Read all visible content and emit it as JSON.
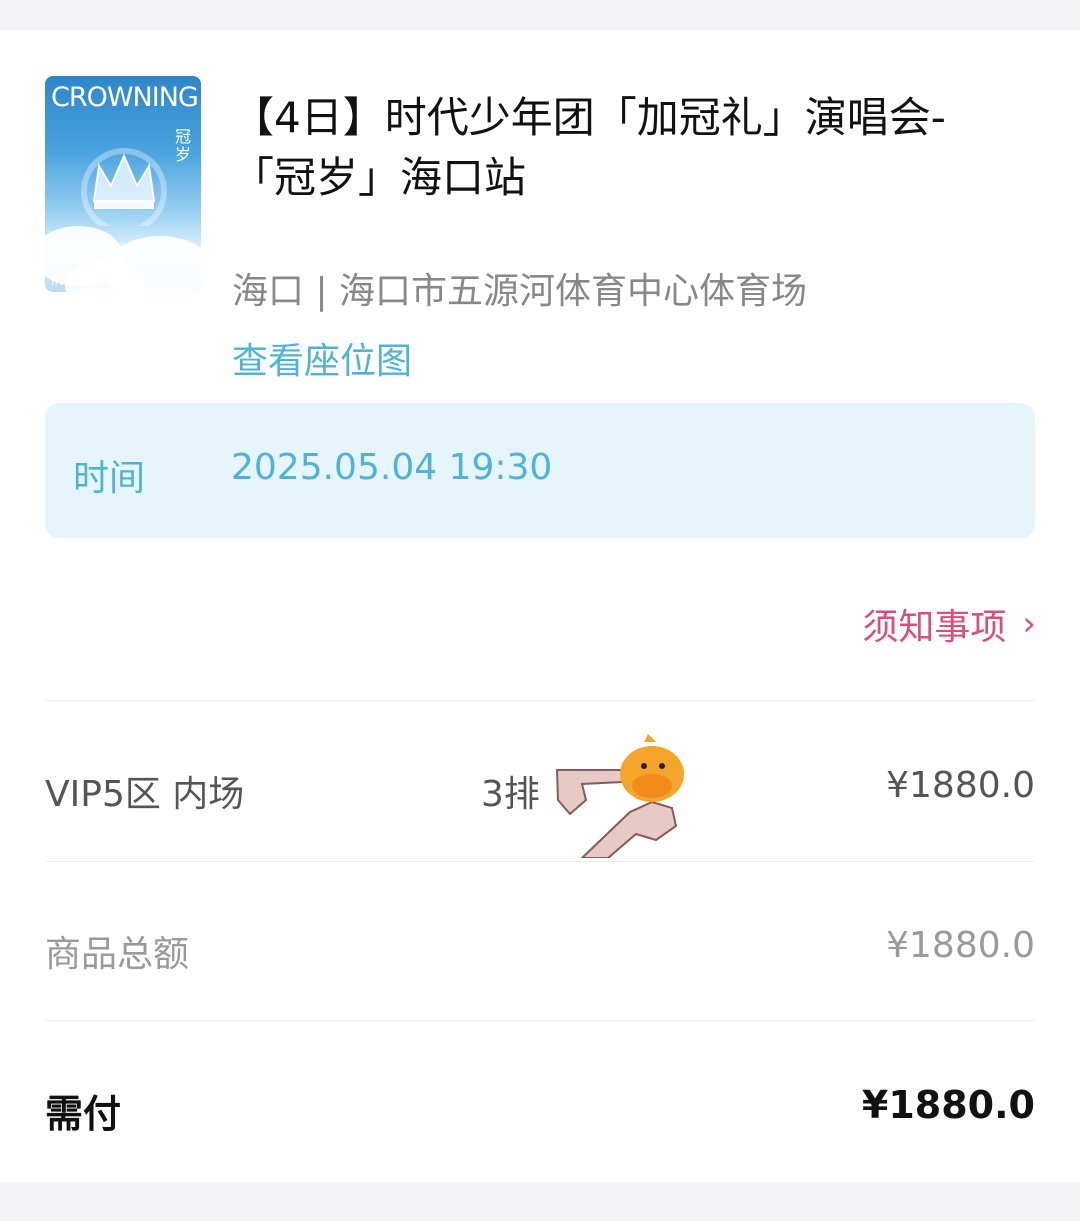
{
  "event": {
    "poster_title": "CROWNING",
    "poster_vertical": "冠岁",
    "poster_corner": "IN",
    "title": "【4日】时代少年团「加冠礼」演唱会-「冠岁」海口站",
    "venue": "海口 | 海口市五源河体育中心体育场",
    "seat_map_link": "查看座位图"
  },
  "time": {
    "label": "时间",
    "value": "2025.05.04 19:30"
  },
  "notice": {
    "label": "须知事项",
    "chevron": "›"
  },
  "ticket": {
    "zone": "VIP5区 内场",
    "row": "3排",
    "price": "¥1880.0"
  },
  "subtotal": {
    "label": "商品总额",
    "value": "¥1880.0"
  },
  "payable": {
    "label": "需付",
    "value": "¥1880.0"
  },
  "colors": {
    "accent_blue": "#4fb3d8",
    "time_bg": "#e6f5fc",
    "notice_pink": "#d94f7b"
  },
  "icons": {
    "notice_chevron": "chevron-right-icon",
    "sticker": "pointing-hand-duck-sticker"
  }
}
